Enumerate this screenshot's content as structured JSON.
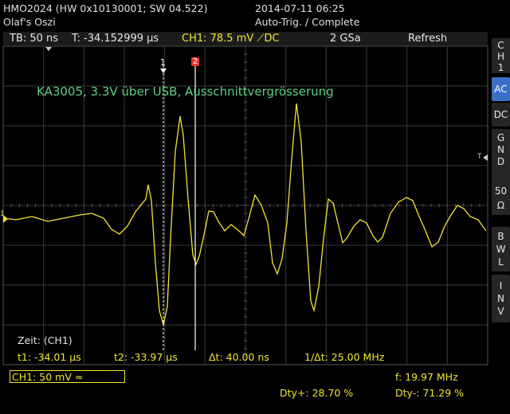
{
  "header": {
    "model": "HMO2024 (HW 0x10130001; SW 04.522)",
    "name": "Olaf's Oszi",
    "datetime": "2014-07-11 06:25",
    "trig_status": "Auto-Trig. / Complete"
  },
  "topbar": {
    "timebase": "TB: 50 ns",
    "trigger_time": "T: -34.152999 µs",
    "channel_info": "CH1: 78.5 mV ⟋DC",
    "sample_rate": "2 GSa",
    "refresh": "Refresh"
  },
  "annotation": "KA3005, 3.3V über USB, Ausschnittvergrösserung",
  "cursors": {
    "c1_label": "1",
    "c2_label": "2",
    "trig_marker": "T",
    "ch_marker": "1"
  },
  "measurements": {
    "title": "Zeit: (CH1)",
    "t1": "t1: -34.01 µs",
    "t2": "t2: -33.97 µs",
    "dt": "Δt: 40.00 ns",
    "inv_dt": "1/Δt: 25.00 MHz"
  },
  "bottom": {
    "ch_scale": "CH1: 50 mV ≈",
    "freq": "f: 19.97 MHz",
    "dty_pos": "Dty+: 28.70 %",
    "dty_neg": "Dty-: 71.29 %"
  },
  "side": {
    "channel": [
      "C",
      "H",
      "1"
    ],
    "coupling": [
      "AC",
      "DC"
    ],
    "gnd": [
      "G",
      "N",
      "D"
    ],
    "imp": [
      "50",
      "Ω"
    ],
    "bwl": [
      "B",
      "W",
      "L"
    ],
    "inv": [
      "I",
      "N",
      "V"
    ]
  },
  "colors": {
    "trace": "#f2e634",
    "annotation": "#5fd080",
    "accent": "#3a70c8",
    "cursor2": "#e8362a"
  }
}
